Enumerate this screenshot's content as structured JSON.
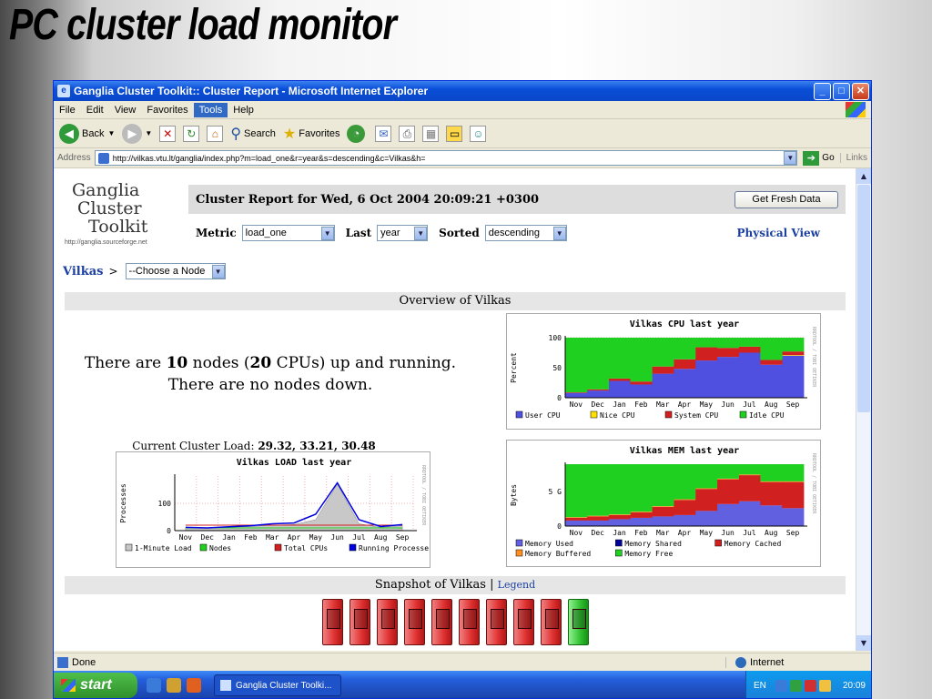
{
  "slide": {
    "title": "PC cluster load monitor"
  },
  "window": {
    "title": "Ganglia Cluster Toolkit:: Cluster Report - Microsoft Internet Explorer",
    "min": "_",
    "max": "□",
    "close": "✕"
  },
  "menu": [
    "File",
    "Edit",
    "View",
    "Favorites",
    "Tools",
    "Help"
  ],
  "toolbar": {
    "back": "Back",
    "search": "Search",
    "favorites": "Favorites"
  },
  "address": {
    "label": "Address",
    "url": "http://vilkas.vtu.lt/ganglia/index.php?m=load_one&r=year&s=descending&c=Vilkas&h=",
    "go": "Go",
    "links": "Links"
  },
  "page": {
    "logo": {
      "line1": "Ganglia",
      "line2": "Cluster",
      "line3": "Toolkit",
      "url": "http://ganglia.sourceforge.net"
    },
    "report_title": "Cluster Report for Wed, 6 Oct 2004 20:09:21 +0300",
    "fresh_button": "Get Fresh Data",
    "metric_label": "Metric",
    "metric_value": "load_one",
    "last_label": "Last",
    "last_value": "year",
    "sorted_label": "Sorted",
    "sorted_value": "descending",
    "physical_view": "Physical View",
    "cluster": "Vilkas",
    "crumb_sep": ">",
    "node_choice": "--Choose a Node",
    "overview_title": "Overview of Vilkas",
    "status_pre": "There are ",
    "status_nodes": "10",
    "status_mid": " nodes (",
    "status_cpus": "20",
    "status_post": " CPUs) up and running.",
    "status_down": "There are no nodes down.",
    "load_label": "Current Cluster Load: ",
    "load_values": "29.32, 33.21, 30.48",
    "snapshot_title": "Snapshot of Vilkas",
    "snapshot_sep": "|",
    "legend_link": "Legend"
  },
  "node_states": [
    "down",
    "down",
    "down",
    "down",
    "down",
    "down",
    "down",
    "down",
    "down",
    "up"
  ],
  "status": {
    "left": "Done",
    "zone": "Internet"
  },
  "taskbar": {
    "start": "start",
    "task": "Ganglia Cluster Toolki...",
    "lang": "EN",
    "time": "20:09"
  },
  "colors": {
    "user_cpu": "#5050e0",
    "nice_cpu": "#ffe000",
    "system_cpu": "#d02020",
    "idle_cpu": "#20d020",
    "load": "#c8c8c8",
    "running": "#0000e0",
    "mem_used": "#6060e0",
    "mem_shared": "#0000a0",
    "mem_cached": "#d02020",
    "mem_buffered": "#ff9020",
    "mem_free": "#20d020"
  },
  "chart_data": [
    {
      "type": "area",
      "title": "Vilkas CPU last year",
      "ylabel": "Percent",
      "side_label": "RRDTOOL / TOBI OETIKER",
      "x": [
        "Nov",
        "Dec",
        "Jan",
        "Feb",
        "Mar",
        "Apr",
        "May",
        "Jun",
        "Jul",
        "Aug",
        "Sep"
      ],
      "ylim": [
        0,
        100
      ],
      "yticks": [
        0,
        50,
        100
      ],
      "series": [
        {
          "name": "User CPU",
          "values": [
            8,
            12,
            28,
            22,
            40,
            48,
            62,
            68,
            75,
            55,
            70
          ]
        },
        {
          "name": "Nice CPU",
          "values": [
            0,
            0,
            0,
            0,
            0,
            0,
            0,
            0,
            0,
            0,
            1
          ]
        },
        {
          "name": "System CPU",
          "values": [
            1,
            2,
            4,
            5,
            12,
            16,
            22,
            15,
            10,
            8,
            6
          ]
        },
        {
          "name": "Idle CPU",
          "values": [
            91,
            86,
            68,
            73,
            48,
            36,
            16,
            17,
            15,
            37,
            23
          ]
        }
      ]
    },
    {
      "type": "line",
      "title": "Vilkas LOAD last year",
      "ylabel": "Processes",
      "side_label": "RRDTOOL / TOBI OETIKER",
      "x": [
        "Nov",
        "Dec",
        "Jan",
        "Feb",
        "Mar",
        "Apr",
        "May",
        "Jun",
        "Jul",
        "Aug",
        "Sep"
      ],
      "ylim": [
        0,
        200
      ],
      "yticks": [
        0,
        100
      ],
      "series": [
        {
          "name": "1-Minute Load",
          "values": [
            10,
            8,
            12,
            15,
            20,
            22,
            40,
            170,
            25,
            12,
            18
          ]
        },
        {
          "name": "Nodes",
          "values": [
            10,
            10,
            10,
            10,
            10,
            10,
            10,
            10,
            10,
            10,
            10
          ]
        },
        {
          "name": "Total CPUs",
          "values": [
            20,
            20,
            20,
            20,
            20,
            20,
            20,
            20,
            20,
            20,
            20
          ]
        },
        {
          "name": "Running Processes",
          "values": [
            12,
            10,
            14,
            18,
            25,
            28,
            60,
            175,
            40,
            15,
            22
          ]
        }
      ]
    },
    {
      "type": "area",
      "title": "Vilkas MEM last year",
      "ylabel": "Bytes",
      "side_label": "RRDTOOL / TOBI OETIKER",
      "x": [
        "Nov",
        "Dec",
        "Jan",
        "Feb",
        "Mar",
        "Apr",
        "May",
        "Jun",
        "Jul",
        "Aug",
        "Sep"
      ],
      "ylim": [
        0,
        9
      ],
      "yticks": [
        {
          "value": 0,
          "label": "0"
        },
        {
          "value": 5,
          "label": "5 G"
        }
      ],
      "series": [
        {
          "name": "Memory Used",
          "values": [
            0.8,
            0.8,
            1.0,
            1.2,
            1.4,
            1.6,
            2.2,
            3.2,
            3.6,
            3.0,
            2.6
          ]
        },
        {
          "name": "Memory Shared",
          "values": [
            0,
            0,
            0,
            0,
            0,
            0,
            0,
            0,
            0,
            0,
            0
          ]
        },
        {
          "name": "Memory Cached",
          "values": [
            0.4,
            0.6,
            0.6,
            0.8,
            1.4,
            2.2,
            3.2,
            3.6,
            3.8,
            3.4,
            3.8
          ]
        },
        {
          "name": "Memory Buffered",
          "values": [
            0.1,
            0.1,
            0.1,
            0.1,
            0.1,
            0.1,
            0.1,
            0.1,
            0.1,
            0.1,
            0.1
          ]
        },
        {
          "name": "Memory Free",
          "values": [
            7.7,
            7.5,
            7.3,
            6.9,
            6.1,
            5.1,
            3.5,
            2.1,
            1.5,
            2.5,
            2.5
          ]
        }
      ]
    }
  ]
}
